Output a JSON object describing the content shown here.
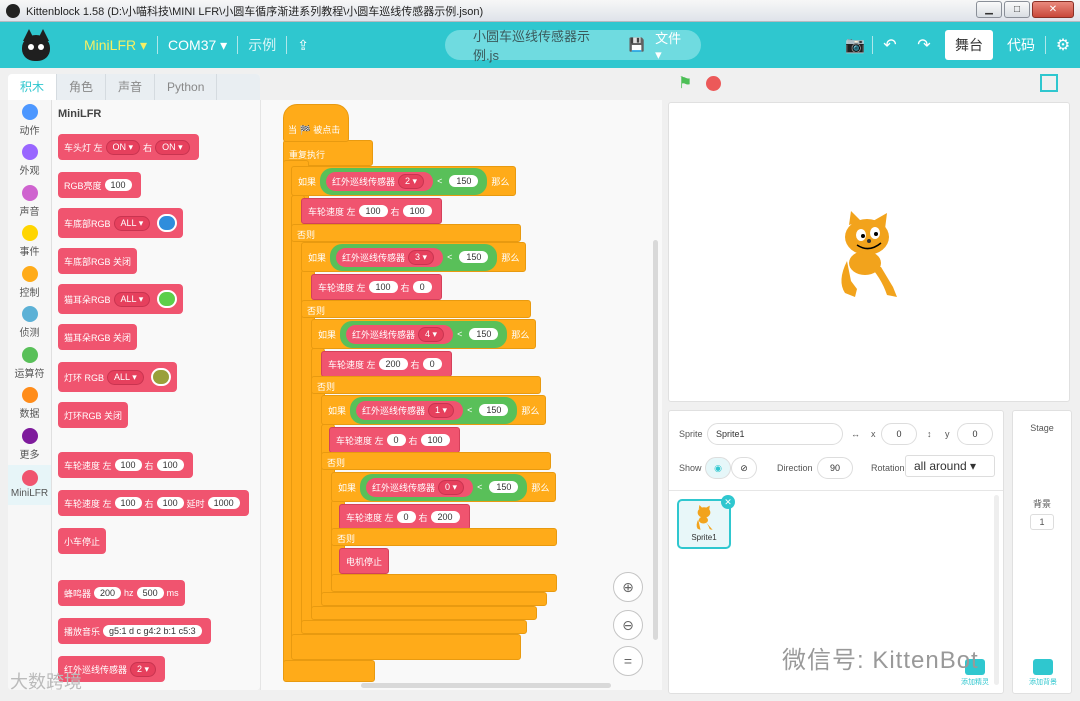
{
  "window": {
    "title": "Kittenblock 1.58 (D:\\小喵科技\\MINI LFR\\小圆车循序渐进系列教程\\小圆车巡线传感器示例.json)",
    "minimize": "▁",
    "maximize": "□",
    "close": "✕"
  },
  "menubar": {
    "device": "MiniLFR ▾",
    "port": "COM37 ▾",
    "examples": "示例",
    "upload_icon": "upload-icon",
    "filename": "小圆车巡线传感器示例.js",
    "file_menu": "文件 ▾",
    "stage_tab": "舞台",
    "code_tab": "代码"
  },
  "tabs": [
    "积木",
    "角色",
    "声音",
    "Python"
  ],
  "categories": [
    {
      "label": "动作",
      "color": "#4c97ff"
    },
    {
      "label": "外观",
      "color": "#9966ff"
    },
    {
      "label": "声音",
      "color": "#cf63cf"
    },
    {
      "label": "事件",
      "color": "#ffd500"
    },
    {
      "label": "控制",
      "color": "#ffab19"
    },
    {
      "label": "侦测",
      "color": "#5cb1d6"
    },
    {
      "label": "运算符",
      "color": "#59c059"
    },
    {
      "label": "数据",
      "color": "#ff8c1a"
    },
    {
      "label": "更多",
      "color": "#7e1b9c"
    },
    {
      "label": "MiniLFR",
      "color": "#f0546f"
    }
  ],
  "palette": {
    "title": "MiniLFR",
    "b1": {
      "text": "车头灯 左",
      "v1": "ON ▾",
      "mid": "右",
      "v2": "ON ▾"
    },
    "b2": {
      "text": "RGB亮度",
      "v1": "100"
    },
    "b3": {
      "text": "车底部RGB",
      "v1": "ALL ▾"
    },
    "b4": {
      "text": "车底部RGB 关闭"
    },
    "b5": {
      "text": "猫耳朵RGB",
      "v1": "ALL ▾"
    },
    "b6": {
      "text": "猫耳朵RGB 关闭"
    },
    "b7": {
      "text": "灯环 RGB",
      "v1": "ALL ▾"
    },
    "b8": {
      "text": "灯环RGB 关闭"
    },
    "b9": {
      "text": "车轮速度 左",
      "v1": "100",
      "mid": "右",
      "v2": "100"
    },
    "b10": {
      "text": "车轮速度 左",
      "v1": "100",
      "mid": "右",
      "v2": "100",
      "mid2": "延时",
      "v3": "1000"
    },
    "b11": {
      "text": "小车停止"
    },
    "b12": {
      "text": "蜂鸣器",
      "v1": "200",
      "mid": "hz",
      "v2": "500",
      "end": "ms"
    },
    "b13": {
      "text": "播放音乐",
      "v1": "g5:1 d c g4:2 b:1 c5:3"
    },
    "b14": {
      "text": "红外巡线传感器",
      "v1": "2 ▾"
    },
    "swatch_blue": "#2f8ddc",
    "swatch_green": "#5ccf4a",
    "swatch_olive": "#9aa03a"
  },
  "script": {
    "hat": "当 🏁 被点击",
    "forever": "重复执行",
    "if": "如果",
    "then": "那么",
    "else": "否则",
    "sensor": "红外巡线传感器",
    "lt": "<",
    "c1": {
      "port": "2 ▾",
      "val": "150"
    },
    "m1": {
      "text": "车轮速度 左",
      "l": "100",
      "r": "右",
      "rv": "100"
    },
    "c2": {
      "port": "3 ▾",
      "val": "150"
    },
    "m2": {
      "text": "车轮速度 左",
      "l": "100",
      "r": "右",
      "rv": "0"
    },
    "c3": {
      "port": "4 ▾",
      "val": "150"
    },
    "m3": {
      "text": "车轮速度 左",
      "l": "200",
      "r": "右",
      "rv": "0"
    },
    "c4": {
      "port": "1 ▾",
      "val": "150"
    },
    "m4": {
      "text": "车轮速度 左",
      "l": "0",
      "r": "右",
      "rv": "100"
    },
    "c5": {
      "port": "0 ▾",
      "val": "150"
    },
    "m5": {
      "text": "车轮速度 左",
      "l": "0",
      "r": "右",
      "rv": "200"
    },
    "stop": "电机停止"
  },
  "zoom": {
    "in": "⊕",
    "out": "⊖",
    "reset": "="
  },
  "sprite": {
    "label": "Sprite",
    "name": "Sprite1",
    "x_label": "x",
    "x": "0",
    "y_label": "y",
    "y": "0",
    "show": "Show",
    "direction_label": "Direction",
    "direction": "90",
    "rotation_label": "Rotation",
    "rotation": "all around ▾",
    "tile_name": "Sprite1"
  },
  "stage_panel": {
    "title": "Stage",
    "backdrop_label": "背景",
    "backdrop_count": "1"
  },
  "buttons": {
    "add_sprite": "添加精灵",
    "add_backdrop": "添加背景"
  },
  "watermark_left": "大数跨境",
  "watermark_right": "微信号: KittenBot"
}
